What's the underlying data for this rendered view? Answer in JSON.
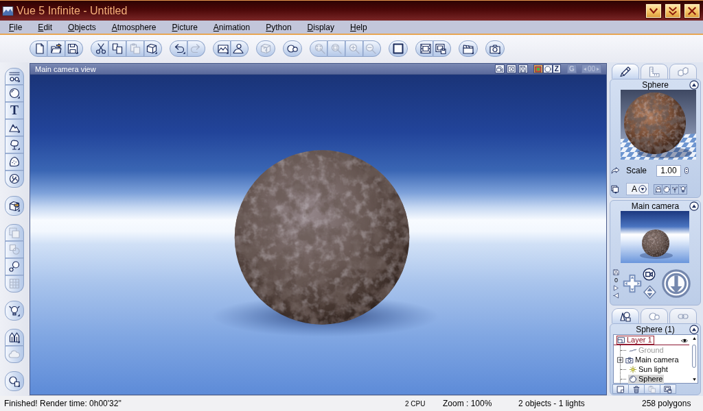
{
  "window": {
    "title": "Vue 5 Infinite - Untitled"
  },
  "menu": [
    "File",
    "Edit",
    "Objects",
    "Atmosphere",
    "Picture",
    "Animation",
    "Python",
    "Display",
    "Help"
  ],
  "toolbar": [
    {
      "buttons": [
        {
          "disabled": false
        },
        {
          "disabled": false
        },
        {
          "disabled": false
        }
      ]
    },
    {
      "buttons": [
        {
          "disabled": false
        },
        {
          "disabled": false
        },
        {
          "disabled": true
        },
        {
          "disabled": false
        }
      ]
    },
    {
      "buttons": [
        {
          "disabled": false
        },
        {
          "disabled": true
        }
      ]
    },
    {
      "buttons": [
        {
          "disabled": false
        },
        {
          "disabled": false
        }
      ]
    },
    {
      "buttons": [
        {
          "disabled": true
        }
      ]
    },
    {
      "buttons": [
        {
          "disabled": false
        }
      ]
    },
    {
      "buttons": [
        {
          "disabled": true
        },
        {
          "disabled": true
        },
        {
          "disabled": true
        },
        {
          "disabled": true
        }
      ]
    },
    {
      "buttons": [
        {
          "disabled": false
        }
      ]
    },
    {
      "buttons": [
        {
          "disabled": false
        },
        {
          "disabled": false
        }
      ]
    },
    {
      "buttons": [
        {
          "disabled": false
        }
      ]
    },
    {
      "buttons": [
        {
          "disabled": false
        }
      ]
    }
  ],
  "palette": [
    {
      "buttons": [
        {
          "disabled": false
        },
        {
          "disabled": false
        },
        {
          "glyph": "T",
          "disabled": false
        },
        {
          "disabled": false
        },
        {
          "disabled": false
        },
        {
          "disabled": false
        },
        {
          "disabled": false
        }
      ]
    },
    {
      "buttons": [
        {
          "disabled": false
        }
      ]
    },
    {
      "buttons": [
        {
          "disabled": true
        },
        {
          "disabled": true
        },
        {
          "disabled": false
        },
        {
          "disabled": true
        }
      ]
    },
    {
      "buttons": [
        {
          "disabled": false
        }
      ]
    },
    {
      "buttons": [
        {
          "disabled": false
        },
        {
          "disabled": true
        }
      ]
    },
    {
      "buttons": [
        {
          "disabled": false
        }
      ]
    }
  ],
  "viewport": {
    "title": "Main camera view",
    "view_modes": [
      {
        "selected": true
      },
      {
        "selected": false
      },
      {
        "label": "Z",
        "selected": false
      }
    ],
    "guide_button": {
      "label": "G",
      "disabled": true
    },
    "frame_field": {
      "value": "00",
      "disabled": true
    }
  },
  "side_panel": {
    "tabs": [
      {
        "selected": true
      },
      {
        "selected": false
      },
      {
        "selected": false
      }
    ],
    "object": {
      "title": "Sphere",
      "scale_label": "Scale",
      "scale_value": "1.00",
      "channel": "A"
    },
    "camera": {
      "title": "Main camera",
      "frame": "0"
    },
    "world_tabs": [
      {
        "selected": true
      },
      {
        "selected": false
      },
      {
        "selected": false
      }
    ],
    "layers": {
      "title": "Sphere (1)",
      "tree": [
        {
          "label": "Layer 1",
          "selected": true,
          "visible": true,
          "children": [
            {
              "label": "Ground",
              "kind": "ground",
              "collapsed": false,
              "disabled": true,
              "selected": false
            },
            {
              "label": "Main camera",
              "kind": "camera",
              "collapsed": true,
              "disabled": false,
              "selected": false
            },
            {
              "label": "Sun light",
              "kind": "light",
              "collapsed": false,
              "disabled": false,
              "selected": false
            },
            {
              "label": "Sphere",
              "kind": "sphere",
              "collapsed": false,
              "disabled": false,
              "selected": true
            }
          ]
        }
      ],
      "actions": [
        {
          "disabled": false
        },
        {
          "disabled": false
        },
        {
          "disabled": true
        },
        {
          "disabled": false
        }
      ]
    }
  },
  "status_bar": {
    "message": "Finished! Render time: 0h00'32\"",
    "cpu": "2 CPU",
    "zoom": "Zoom : 100%",
    "scene": "2 objects - 1 lights",
    "polygons": "258 polygons"
  }
}
